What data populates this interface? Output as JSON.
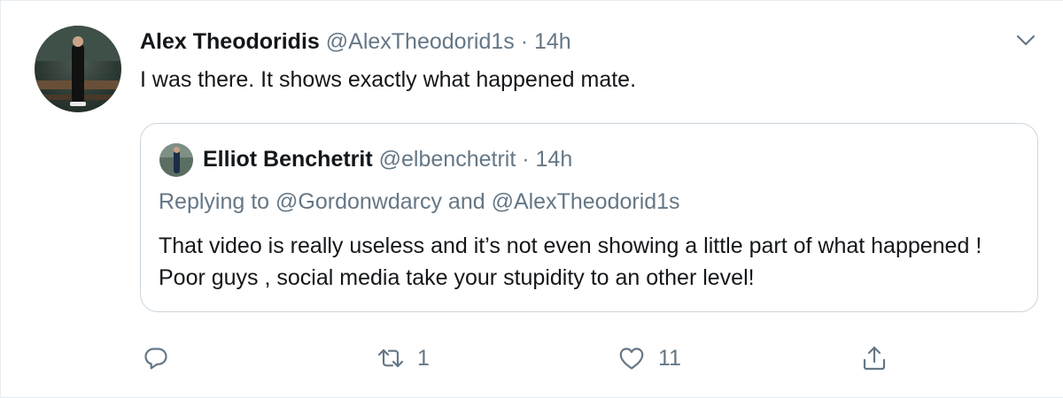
{
  "tweet": {
    "author_name": "Alex Theodoridis",
    "author_handle": "@AlexTheodorid1s",
    "separator": "·",
    "time": "14h",
    "text": "I was there. It shows exactly what happened mate.",
    "avatar_icon": "profile-photo",
    "caret_icon": "chevron-down-icon"
  },
  "quoted_tweet": {
    "author_name": "Elliot Benchetrit",
    "author_handle": "@elbenchetrit",
    "separator": "·",
    "time": "14h",
    "replying_to": "Replying to @Gordonwdarcy and @AlexTheodorid1s",
    "text": "That video is really useless and it’s not even showing a little part of what happened ! Poor guys , social media take your stupidity to an other level!"
  },
  "actions": {
    "reply_icon": "reply-icon",
    "retweet_icon": "retweet-icon",
    "retweet_count": "1",
    "like_icon": "heart-icon",
    "like_count": "11",
    "share_icon": "share-icon"
  },
  "colors": {
    "text_primary": "#14171a",
    "text_secondary": "#657786",
    "border": "#ccd6dd",
    "divider": "#e6ecf0"
  }
}
